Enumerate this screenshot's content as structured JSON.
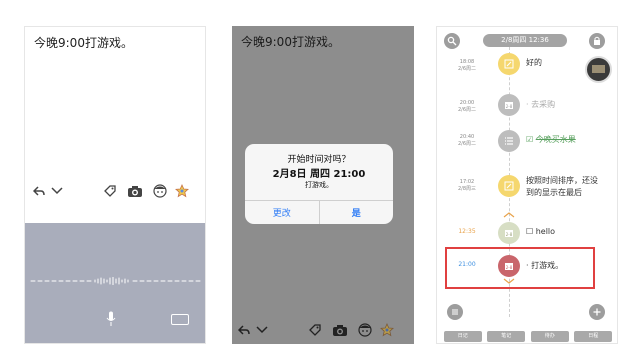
{
  "screen1": {
    "note_text": "今晚9:00打游戏。"
  },
  "screen2": {
    "note_text": "今晚9:00打游戏。",
    "dialog": {
      "title": "开始时间对吗？",
      "date": "2月8日 周四 21:00",
      "message": "打游戏。",
      "btn_edit": "更改",
      "btn_ok": "是"
    }
  },
  "screen3": {
    "date_header": "2/8周四 12:36",
    "entries": [
      {
        "time": "18:08",
        "date": "2/6周二",
        "text": "好的",
        "done": false
      },
      {
        "time": "20:00",
        "date": "2/6周二",
        "text": "去采购",
        "done": true
      },
      {
        "time": "20:40",
        "date": "2/6周二",
        "text": "今晚买水果",
        "done": true
      },
      {
        "time": "17:02",
        "date": "2/8周三",
        "text": "按照时间排序，还没到的显示在最后",
        "done": false
      },
      {
        "time": "12:35",
        "date": "",
        "text": "hello",
        "done": false
      },
      {
        "time": "21:00",
        "date": "",
        "text": "打游戏。",
        "done": false
      }
    ],
    "tabs": [
      "日记",
      "笔记",
      "待办",
      "日程"
    ]
  },
  "colors": {
    "accent_blue": "#2e7cf6",
    "timeline_yellow": "#f5d76e",
    "highlight_red": "#e04040",
    "hello_time_orange": "#e8a24a",
    "game_time_blue": "#3d8fe0"
  }
}
